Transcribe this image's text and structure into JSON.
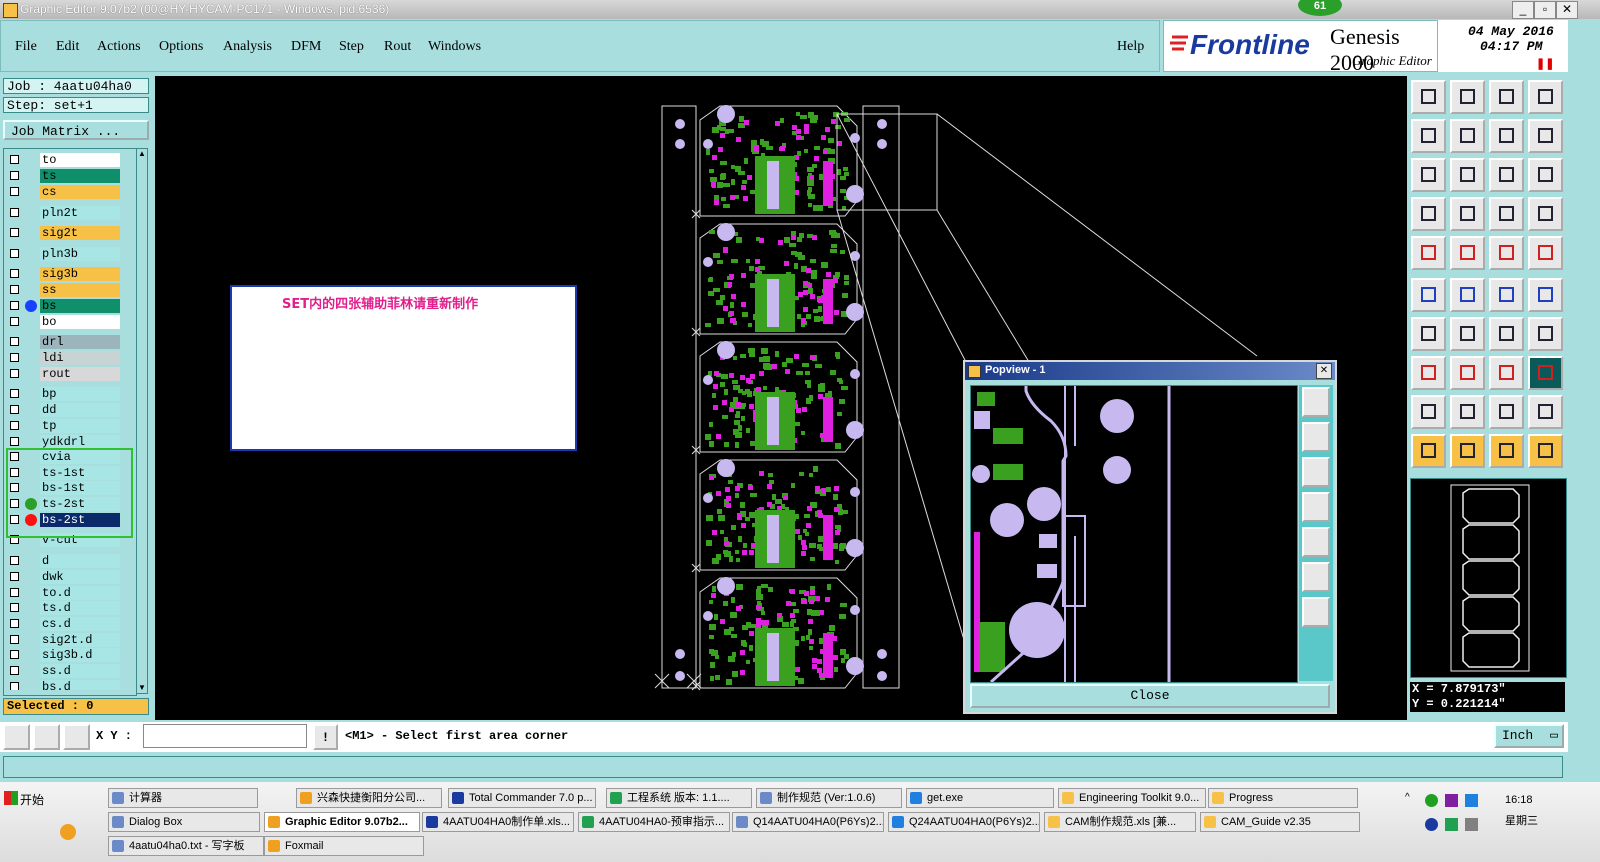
{
  "window": {
    "title": "Graphic Editor 9.07b2 (00@HY-HYCAM-PC171 - Windows, pid:6536)",
    "badge": "61"
  },
  "menu": {
    "items": [
      "File",
      "Edit",
      "Actions",
      "Options",
      "Analysis",
      "DFM",
      "Step",
      "Rout",
      "Windows"
    ],
    "help": "Help"
  },
  "brand": {
    "logo": "Frontline",
    "product": "Genesis 2000",
    "subtitle": "Graphic Editor",
    "date": "04 May 2016",
    "time": "04:17 PM"
  },
  "job": {
    "job_line": "Job : 4aatu04ha0",
    "step_line": "Step: set+1",
    "matrix_button": "Job Matrix ..."
  },
  "layers": [
    {
      "name": "to",
      "bg": "#ffffff",
      "dot": ""
    },
    {
      "name": "ts",
      "bg": "#0f8f6a",
      "dot": ""
    },
    {
      "name": "cs",
      "bg": "#f6c146",
      "dot": ""
    },
    {
      "name": "pln2t",
      "bg": "#a8e6e6",
      "dot": ""
    },
    {
      "name": "sig2t",
      "bg": "#f6c146",
      "dot": ""
    },
    {
      "name": "pln3b",
      "bg": "#a8e6e6",
      "dot": ""
    },
    {
      "name": "sig3b",
      "bg": "#f6c146",
      "dot": ""
    },
    {
      "name": "ss",
      "bg": "#f6c146",
      "dot": ""
    },
    {
      "name": "bs",
      "bg": "#0f8f6a",
      "dot": "#1840ff"
    },
    {
      "name": "bo",
      "bg": "#ffffff",
      "dot": ""
    },
    {
      "name": "drl",
      "bg": "#9cb4bc",
      "dot": ""
    },
    {
      "name": "ldi",
      "bg": "#c8d4d4",
      "dot": ""
    },
    {
      "name": "rout",
      "bg": "#d8d8d8",
      "dot": ""
    },
    {
      "name": "bp",
      "bg": "#a8e6e6",
      "dot": ""
    },
    {
      "name": "dd",
      "bg": "#a8e6e6",
      "dot": ""
    },
    {
      "name": "tp",
      "bg": "#a8e6e6",
      "dot": ""
    },
    {
      "name": "ydkdrl",
      "bg": "#a8e6e6",
      "dot": ""
    },
    {
      "name": "cvia",
      "bg": "#a8e6e6",
      "dot": ""
    },
    {
      "name": "ts-1st",
      "bg": "#a8e6e6",
      "dot": ""
    },
    {
      "name": "bs-1st",
      "bg": "#a8e6e6",
      "dot": ""
    },
    {
      "name": "ts-2st",
      "bg": "#a8e6e6",
      "dot": "#2aa02a"
    },
    {
      "name": "bs-2st",
      "bg": "#0a2a6a",
      "dot": "#ff1010"
    },
    {
      "name": "v-cut",
      "bg": "#a8e6e6",
      "dot": ""
    },
    {
      "name": "d",
      "bg": "#a8e6e6",
      "dot": ""
    },
    {
      "name": "dwk",
      "bg": "#a8e6e6",
      "dot": ""
    },
    {
      "name": "to.d",
      "bg": "#a8e6e6",
      "dot": ""
    },
    {
      "name": "ts.d",
      "bg": "#a8e6e6",
      "dot": ""
    },
    {
      "name": "cs.d",
      "bg": "#a8e6e6",
      "dot": ""
    },
    {
      "name": "sig2t.d",
      "bg": "#a8e6e6",
      "dot": ""
    },
    {
      "name": "sig3b.d",
      "bg": "#a8e6e6",
      "dot": ""
    },
    {
      "name": "ss.d",
      "bg": "#a8e6e6",
      "dot": ""
    },
    {
      "name": "bs.d",
      "bg": "#a8e6e6",
      "dot": ""
    }
  ],
  "selected": "Selected : 0",
  "note": {
    "text": "SET内的四张辅助菲林请重新制作"
  },
  "popview": {
    "title": "Popview - 1",
    "close": "Close"
  },
  "coords": {
    "x": "X = 7.879173\"",
    "y": "Y = 0.221214\""
  },
  "status": {
    "xy_label": "X Y :",
    "xy_value": "",
    "message": "<M1> - Select first area corner",
    "units": "Inch"
  },
  "taskbar": {
    "start": "开始",
    "clock_time": "16:18",
    "clock_day": "星期三",
    "row1": [
      "计算器",
      "兴森快捷衡阳分公司...",
      "Total Commander 7.0 p...",
      "工程系统  版本: 1.1....",
      "制作规范 (Ver:1.0.6)",
      "get.exe",
      "Engineering Toolkit 9.0...",
      "Progress"
    ],
    "row2": [
      "Dialog Box",
      "Graphic Editor 9.07b2...",
      "4AATU04HA0制作单.xls...",
      "4AATU04HA0-预审指示...",
      "Q14AATU04HA0(P6Ys)2...",
      "Q24AATU04HA0(P6Ys)2...",
      "CAM制作规范.xls [兼...",
      "CAM_Guide v2.35"
    ],
    "row3": [
      "4aatu04ha0.txt - 写字板",
      "Foxmail"
    ]
  },
  "colors": {
    "panel": "#a8dede",
    "copper_green": "#3aa020",
    "mask_magenta": "#e020e0",
    "pad_lavender": "#c8b8f0",
    "note_text": "#e0208c"
  }
}
